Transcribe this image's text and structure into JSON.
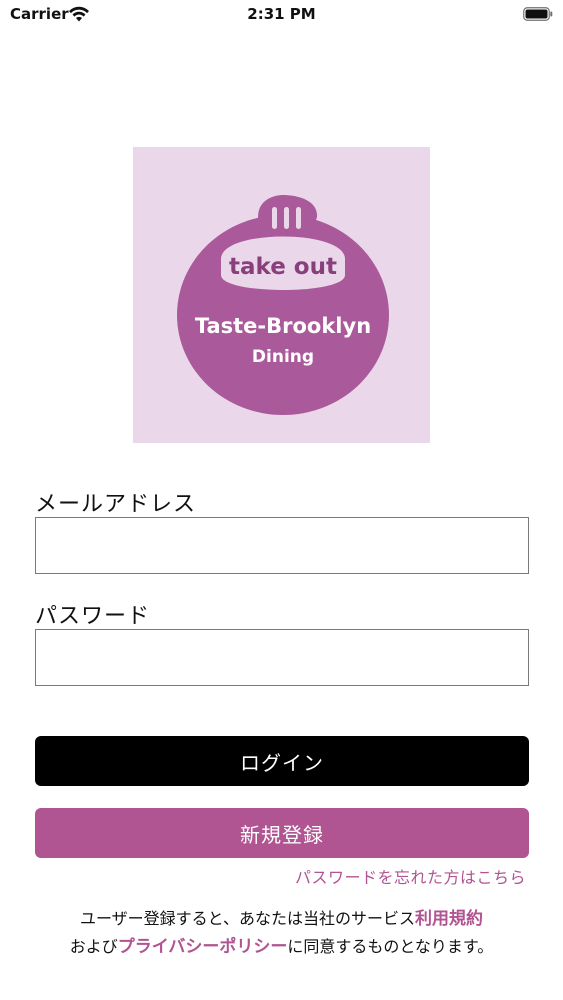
{
  "status_bar": {
    "carrier": "Carrier",
    "time": "2:31 PM"
  },
  "logo": {
    "text_line1": "take out",
    "text_line2": "Taste-Brooklyn",
    "text_line3": "Dining",
    "background_color": "#ead8ea",
    "shape_color": "#aa5a9a"
  },
  "form": {
    "email_label": "メールアドレス",
    "email_value": "",
    "password_label": "パスワード",
    "password_value": "",
    "login_label": "ログイン",
    "signup_label": "新規登録",
    "forgot_password": "パスワードを忘れた方はこちら"
  },
  "terms": {
    "line1_prefix": "ユーザー登録すると、あなたは当社のサービス",
    "terms_link": "利用規約",
    "line2_prefix": "および",
    "privacy_link": "プライバシーポリシー",
    "line2_suffix": "に同意するものとなります。"
  },
  "colors": {
    "accent": "#b05592",
    "login_button": "#000000"
  }
}
